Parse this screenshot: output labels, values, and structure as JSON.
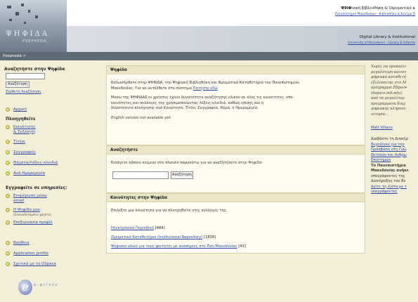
{
  "header": {
    "logo_text": "ΨΗΦΙΔΑ",
    "logo_sub": "PSEPHEDA",
    "gr_title_bold": "ΨΗΦ",
    "gr_title_rest": "ιακή βΙβλιοθήκη & ΙΑρυματικό κ",
    "gr_sub": "Πανεπιστήμιο Μακεδονίας - Βιβλιοθήκη & Κέντρο Π",
    "en_title": "Digital Library & Institutional",
    "en_sub": "University of Macedonia - Library & Informa"
  },
  "breadcrumb": "Psepheda  >",
  "sidebar": {
    "search_title": "Αναζητήστε στην Ψηφίδα",
    "search_button": "Αναζήτηση",
    "advanced_search": "Σύνθετη Αναζήτηση",
    "home": "Αρχική",
    "browse_title": "Πλοηγηθείτε",
    "browse_items": [
      {
        "label": "Κοινότητες",
        "label2": "& Συλλογές"
      },
      {
        "label": "Τίτλοι"
      },
      {
        "label": "Συγγραφείς"
      },
      {
        "label": "Θέματα/Λέξεις-κλειδιά"
      },
      {
        "label": "Ανά Ημερομηνία"
      }
    ],
    "connect_title": "Εγγραφείτε σε υπηρεσίες:",
    "connect_items": [
      {
        "label": "Ενημέρωση μέσω",
        "label2": "email"
      },
      {
        "label": "Η Ψηφίδα μου",
        "sub": "εξουσιοδοτημένοι χρήστες"
      },
      {
        "label": "Επεξεργασία προφίλ"
      }
    ],
    "help_items": [
      "Βοήθεια",
      "Application profile",
      "Σχετικά με το DSpace"
    ],
    "eprints_text": "e-prints"
  },
  "welcome": {
    "heading": "Ψηφίδα",
    "p1_a": "Καλωσήρθατε στην ΨΗΦΙΔΑ, την Ψηφιακή Βιβλιοθήκη και Ιδρυματικό Καταθετήριο του Πανεπιστημίου",
    "p1_b": "Μακεδονίας. Για να αυτέλθετε στο σύστημα ",
    "p1_link": "Πατήστε εδώ",
    "p2_a": "Μέσω της ΨΗΦΙΔΑΣ οι χρήστες έχουν δυνατότητα αναζήτησης υλικού σε όλες τις κοινότητες, υπο-",
    "p2_b": "κοινότητες και συλλογές της χρησιμοποιώντας λέξεις-κλειδιά, καθώς επίσης και η",
    "p2_c": "δυνατότητα πλοήγησης ανά Κοινότητα, Τίτλο, Συγγραφέα, Θέμα, ή Ημερομηνία.",
    "english_note": "English version not available yet."
  },
  "search_box": {
    "heading": "Αναζητήστε",
    "instructions": "Εισάγετε κάποιο κείμενο στο πλαίσιο παρακάτω για να αναζητήσετε στην Ψηφίδα.",
    "button": "Αναζήτηση"
  },
  "communities": {
    "heading": "Κοινότητες στην Ψηφίδα",
    "intro": "Επιλέξτε μια κοινότητα για να πλοηγηθείτε στις συλλογές της.",
    "items": [
      {
        "label": "Ηλεκτρονικό Περιοδικό",
        "count": "[484]"
      },
      {
        "label": "Ιδρυματικό Καταθετήριο (Institutional Repository)",
        "count": "[1838]"
      },
      {
        "label": "Ψηφιακό υλικό για τους φοιτητές με αναπηρίες στο Παν.Μακεδονίας",
        "count": "[43]"
      }
    ]
  },
  "right": {
    "italic_lines": [
      "Χωρίς να προκαλεί",
      "μεγαλύτερη καινοτ",
      "ψηφιακό καταθετή",
      "εξελίσσεται στο Μ",
      "πρόγραμμα DSpace",
      "(dspace.mit.edu) ",
      "από τα μεγαλύτερ",
      "προγράμματα διαχ",
      "ψηφιακής κληρονο",
      "ιστορία..."
    ],
    "ml": "Matt Villano",
    "block2_lines": [
      "Διαβάστε τη Διακήρ",
      "Βερολίνου για την",
      "Πρόσβαση στη Γνώ",
      "Θετικών και Ανθρω",
      "Επιστημών",
      "Το Πανεπιστήμιο",
      "Μακεδονίας ανήκε",
      "υπογράφοντες της",
      "Διακήρυξης του Βε",
      "Δείτε τη λίστα με τ",
      "υπογράφοντες"
    ]
  }
}
